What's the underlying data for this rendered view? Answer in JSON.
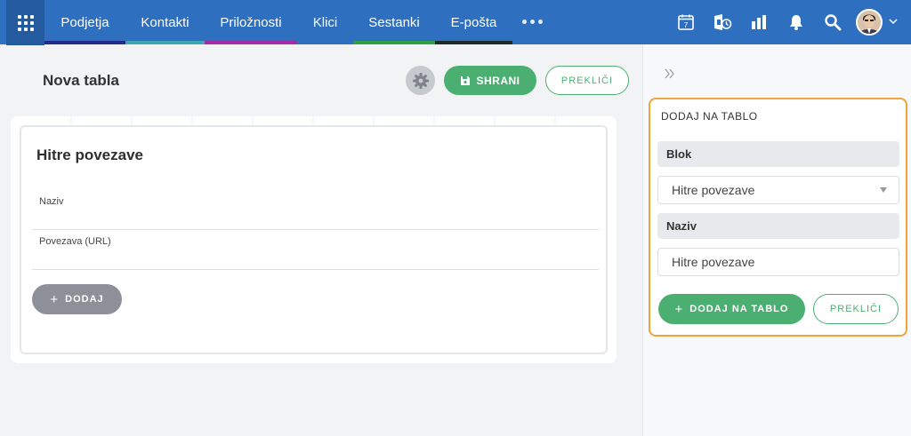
{
  "nav": {
    "items": [
      {
        "label": "Podjetja",
        "color": "#1f2a8c"
      },
      {
        "label": "Kontakti",
        "color": "#39a7b4"
      },
      {
        "label": "Priložnosti",
        "color": "#a62ca5"
      },
      {
        "label": "Klici",
        "color": ""
      },
      {
        "label": "Sestanki",
        "color": "#2e9e47"
      },
      {
        "label": "E-pošta",
        "color": "#1d2a2a"
      }
    ],
    "calendar_day": "7",
    "icons": [
      "apps-grid-icon",
      "more-icon",
      "calendar-icon",
      "exchange-icon",
      "reports-icon",
      "bell-icon",
      "search-icon",
      "avatar",
      "chevron-down-icon"
    ]
  },
  "page": {
    "title": "Nova tabla",
    "save_label": "SHRANI",
    "cancel_label": "PREKLIČI"
  },
  "widget": {
    "title": "Hitre povezave",
    "field_name_label": "Naziv",
    "field_url_label": "Povezava (URL)",
    "add_label": "DODAJ"
  },
  "panel": {
    "title": "DODAJ NA TABLO",
    "block_label": "Blok",
    "block_value": "Hitre povezave",
    "name_label": "Naziv",
    "name_value": "Hitre povezave",
    "add_label": "DODAJ NA TABLO",
    "cancel_label": "PREKLIČI"
  },
  "colors": {
    "nav_bg": "#2f6fbf",
    "primary_green": "#4caf72",
    "highlight_orange": "#f0a43a"
  }
}
